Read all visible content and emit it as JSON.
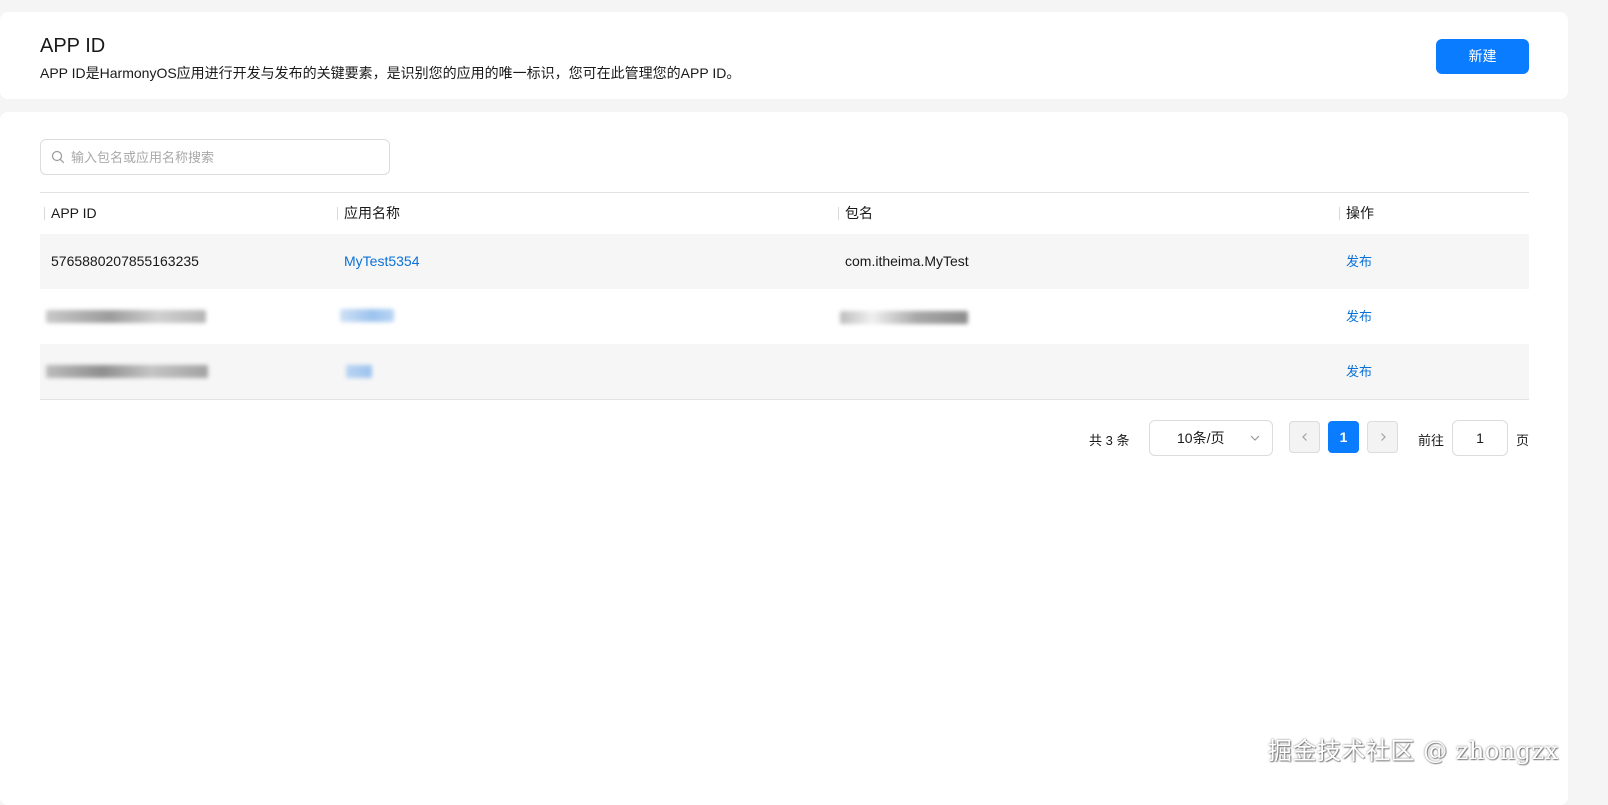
{
  "header": {
    "title": "APP ID",
    "description": "APP ID是HarmonyOS应用进行开发与发布的关键要素，是识别您的应用的唯一标识，您可在此管理您的APP ID。",
    "new_button_label": "新建"
  },
  "search": {
    "placeholder": "输入包名或应用名称搜索",
    "value": ""
  },
  "table": {
    "columns": [
      "APP ID",
      "应用名称",
      "包名",
      "操作"
    ],
    "rows": [
      {
        "app_id": "5765880207855163235",
        "app_name": "MyTest5354",
        "package": "com.itheima.MyTest",
        "action": "发布"
      },
      {
        "app_id": "",
        "app_name": "",
        "package": "",
        "action": "发布"
      },
      {
        "app_id": "",
        "app_name": "",
        "package": "",
        "action": "发布"
      }
    ]
  },
  "pagination": {
    "total_text": "共 3 条",
    "page_size_label": "10条/页",
    "current_page": "1",
    "goto_label": "前往",
    "goto_value": "1",
    "page_suffix": "页"
  },
  "watermark": "掘金技术社区 @ zhongzx",
  "colors": {
    "accent": "#0a7cff",
    "link": "#0a72d6",
    "row_stripe": "#f6f6f6",
    "page_bg": "#f5f5f5"
  }
}
